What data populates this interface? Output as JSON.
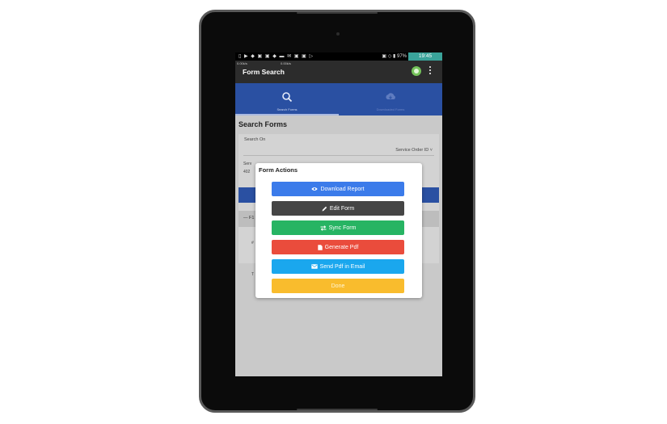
{
  "status_bar": {
    "icons": "▯ ▶ ◆ ▣ ▣ ◆ ▬ ✉ ▣ ▣ ▷",
    "right": "▣ ◇ ▮ 97%",
    "time": "19:45"
  },
  "app_bar": {
    "speed_left": "0.00k/s",
    "speed_right": "0.00k/s",
    "title": "Form Search"
  },
  "tabs": [
    {
      "label": "Search Forms",
      "icon": "search-icon"
    },
    {
      "label": "Downloaded Forms",
      "icon": "cloud-download-icon"
    }
  ],
  "search": {
    "heading": "Search Forms",
    "search_on_label": "Search On",
    "search_on_value": "Service Order ID ˅",
    "service_label": "Serv",
    "service_value": "402",
    "result_header": "— F1",
    "row_a": "#",
    "row_b": "T"
  },
  "dialog": {
    "title": "Form Actions",
    "actions": [
      {
        "label": "Download Report",
        "icon": "eye-icon",
        "color": "#3b7bea"
      },
      {
        "label": "Edit Form",
        "icon": "pencil-icon",
        "color": "#454545"
      },
      {
        "label": "Sync Form",
        "icon": "sync-icon",
        "color": "#27b463"
      },
      {
        "label": "Generate Pdf",
        "icon": "file-icon",
        "color": "#ea4c3c"
      },
      {
        "label": "Send Pdf in Email",
        "icon": "email-icon",
        "color": "#1aa7ee"
      },
      {
        "label": "Done",
        "icon": "",
        "color": "#f9bc2d"
      }
    ]
  },
  "colors": {
    "app_bar": "#2c2c2c",
    "tabs": "#2a50a2",
    "status_time_bg": "#3aa39a"
  }
}
